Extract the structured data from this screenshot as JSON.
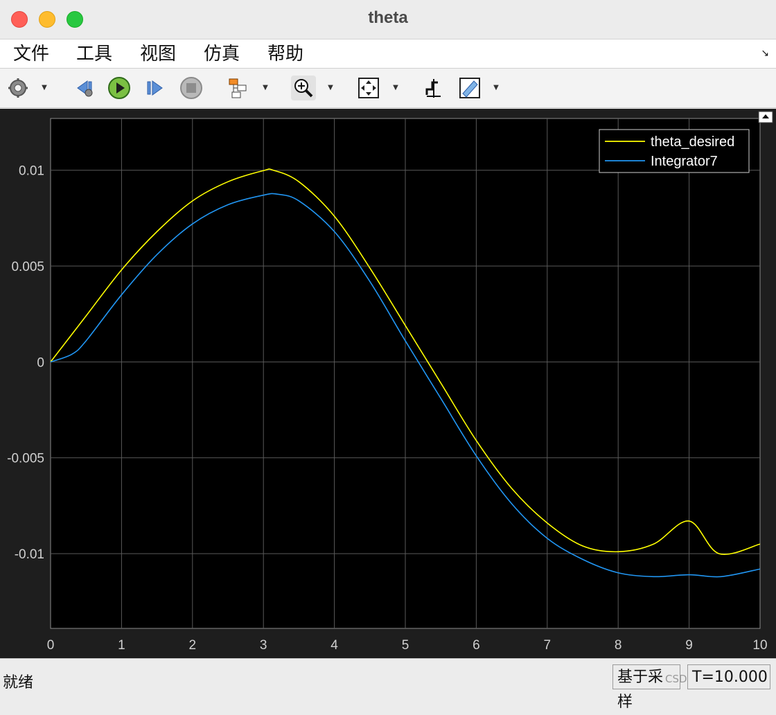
{
  "window": {
    "title": "theta"
  },
  "menu": {
    "items": [
      "文件",
      "工具",
      "视图",
      "仿真",
      "帮助"
    ]
  },
  "toolbar": {
    "icons": [
      "gear-icon",
      "step-back-icon",
      "run-icon",
      "step-forward-icon",
      "stop-icon",
      "signal-selector-icon",
      "zoom-icon",
      "fit-to-view-icon",
      "cursor-measure-icon",
      "ruler-icon"
    ]
  },
  "status": {
    "ready": "就绪",
    "sample_based": "基于采样",
    "time": "T=10.000",
    "watermark": "CSDN @高能灯泡"
  },
  "colors": {
    "background": "#000000",
    "theta_desired": "#ffff00",
    "integrator7": "#2196f3",
    "grid": "#5a5a5a"
  },
  "chart_data": {
    "type": "line",
    "title": "",
    "xlabel": "",
    "ylabel": "",
    "xlim": [
      0,
      10
    ],
    "ylim": [
      -0.0139,
      0.0127
    ],
    "xticks": [
      0,
      1,
      2,
      3,
      4,
      5,
      6,
      7,
      8,
      9,
      10
    ],
    "xtick_labels": [
      "0",
      "1",
      "2",
      "3",
      "4",
      "5",
      "6",
      "7",
      "8",
      "9",
      "10"
    ],
    "yticks": [
      -0.01,
      -0.005,
      0,
      0.005,
      0.01
    ],
    "ytick_labels": [
      "-0.01",
      "-0.005",
      "0",
      "0.005",
      "0.01"
    ],
    "grid": true,
    "legend_position": "top-right",
    "series": [
      {
        "name": "theta_desired",
        "x": [
          0,
          0.5,
          1,
          1.5,
          2,
          2.5,
          3,
          3.14,
          3.5,
          4,
          4.5,
          5,
          5.5,
          6,
          6.5,
          7,
          7.5,
          8,
          8.5,
          9,
          9.42,
          10
        ],
        "y": [
          0,
          0.0024,
          0.0048,
          0.0068,
          0.0084,
          0.0094,
          0.00998,
          0.01,
          0.0094,
          0.0076,
          0.0049,
          0.0019,
          -0.0011,
          -0.0041,
          -0.0066,
          -0.0084,
          -0.0096,
          -0.0099,
          -0.0095,
          -0.0083,
          -0.01,
          -0.0095
        ]
      },
      {
        "name": "Integrator7",
        "x": [
          0,
          0.3,
          0.5,
          1,
          1.5,
          2,
          2.5,
          3,
          3.2,
          3.5,
          4,
          4.5,
          5,
          5.5,
          6,
          6.5,
          7,
          7.5,
          8,
          8.5,
          9,
          9.45,
          10
        ],
        "y": [
          0,
          0.0004,
          0.0011,
          0.0035,
          0.0056,
          0.0072,
          0.0082,
          0.0087,
          0.00875,
          0.0084,
          0.0068,
          0.0042,
          0.0011,
          -0.0019,
          -0.0049,
          -0.0074,
          -0.0092,
          -0.0103,
          -0.011,
          -0.0112,
          -0.0111,
          -0.0112,
          -0.0108
        ]
      }
    ]
  }
}
